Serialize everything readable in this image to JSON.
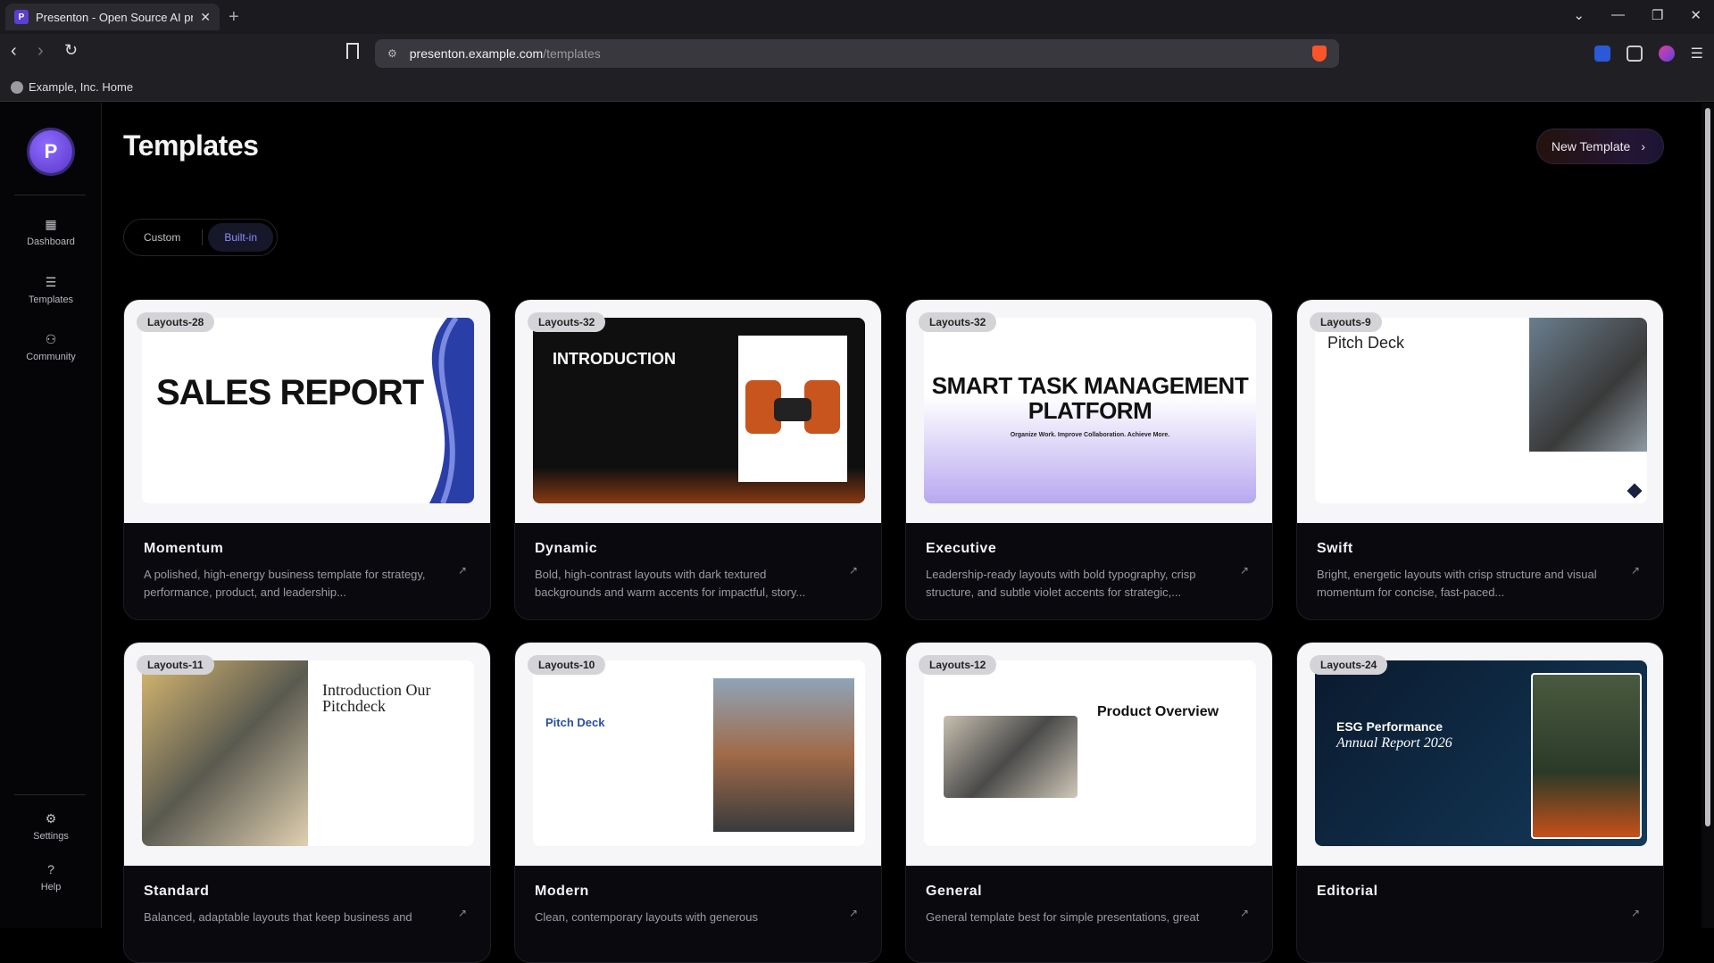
{
  "browser": {
    "tab_title": "Presenton - Open Source AI pre",
    "url_host": "presenton.example.com",
    "url_path": "/templates",
    "bookmark": "Example, Inc. Home"
  },
  "sidebar": {
    "logo_letter": "P",
    "items": [
      {
        "label": "Dashboard",
        "icon": "grid-icon"
      },
      {
        "label": "Templates",
        "icon": "document-icon"
      },
      {
        "label": "Community",
        "icon": "users-icon"
      }
    ],
    "bottom": [
      {
        "label": "Settings",
        "icon": "gear-icon"
      },
      {
        "label": "Help",
        "icon": "help-circle-icon"
      }
    ]
  },
  "page": {
    "title": "Templates",
    "new_template": "New Template",
    "tabs": [
      {
        "label": "Custom",
        "active": false
      },
      {
        "label": "Built-in",
        "active": true
      }
    ]
  },
  "templates": [
    {
      "badge": "Layouts-28",
      "name": "Momentum",
      "desc": "A polished, high-energy business template for strategy, performance, product, and leadership...",
      "slide_title": "SALES REPORT"
    },
    {
      "badge": "Layouts-32",
      "name": "Dynamic",
      "desc": "Bold, high-contrast layouts with dark textured backgrounds and warm accents for impactful, story...",
      "slide_title": "INTRODUCTION"
    },
    {
      "badge": "Layouts-32",
      "name": "Executive",
      "desc": "Leadership-ready layouts with bold typography, crisp structure, and subtle violet accents for strategic,...",
      "slide_title": "SMART TASK MANAGEMENT PLATFORM",
      "slide_sub": "Organize Work. Improve Collaboration. Achieve More."
    },
    {
      "badge": "Layouts-9",
      "name": "Swift",
      "desc": "Bright, energetic layouts with crisp structure and visual momentum for concise, fast-paced...",
      "slide_title": "Pitch Deck"
    },
    {
      "badge": "Layouts-11",
      "name": "Standard",
      "desc": "Balanced, adaptable layouts that keep business and",
      "slide_title": "Introduction Our Pitchdeck"
    },
    {
      "badge": "Layouts-10",
      "name": "Modern",
      "desc": "Clean, contemporary layouts with generous",
      "slide_title": "Pitch Deck"
    },
    {
      "badge": "Layouts-12",
      "name": "General",
      "desc": "General template best for simple presentations, great",
      "slide_title": "Product Overview"
    },
    {
      "badge": "Layouts-24",
      "name": "Editorial",
      "desc": "",
      "slide_title": "ESG Performance",
      "slide_sub": "Annual Report 2026"
    }
  ]
}
